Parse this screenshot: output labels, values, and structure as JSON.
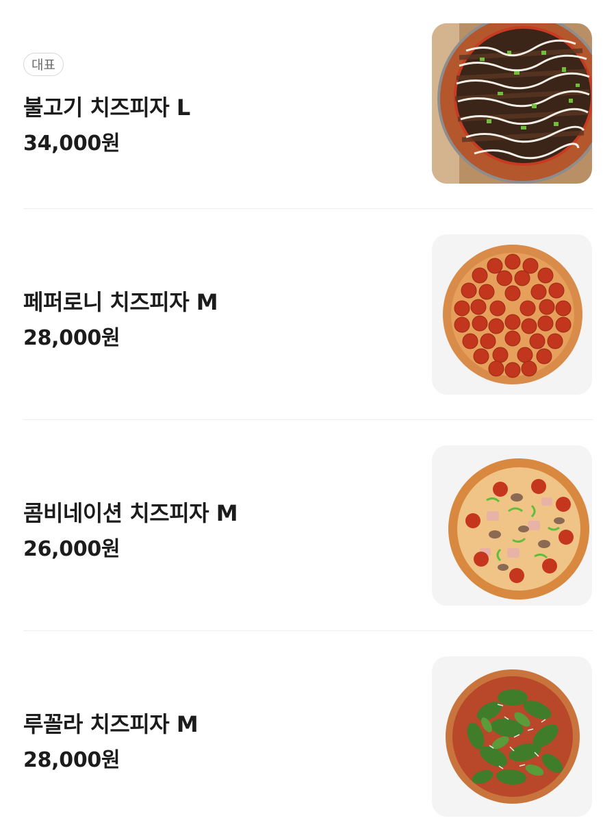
{
  "menu": {
    "items": [
      {
        "badge": "대표",
        "name": "불고기 치즈피자 L",
        "price": "34,000원",
        "image": "bulgogi-pizza-photo"
      },
      {
        "badge": "",
        "name": "페퍼로니 치즈피자 M",
        "price": "28,000원",
        "image": "pepperoni-pizza-photo"
      },
      {
        "badge": "",
        "name": "콤비네이션 치즈피자 M",
        "price": "26,000원",
        "image": "combination-pizza-photo"
      },
      {
        "badge": "",
        "name": "루꼴라 치즈피자 M",
        "price": "28,000원",
        "image": "arugula-pizza-photo"
      }
    ]
  },
  "colors": {
    "text": "#1c1c1c",
    "badge_border": "#d6d6d6",
    "thumb_bg": "#f4f4f4",
    "divider": "#ececec"
  }
}
